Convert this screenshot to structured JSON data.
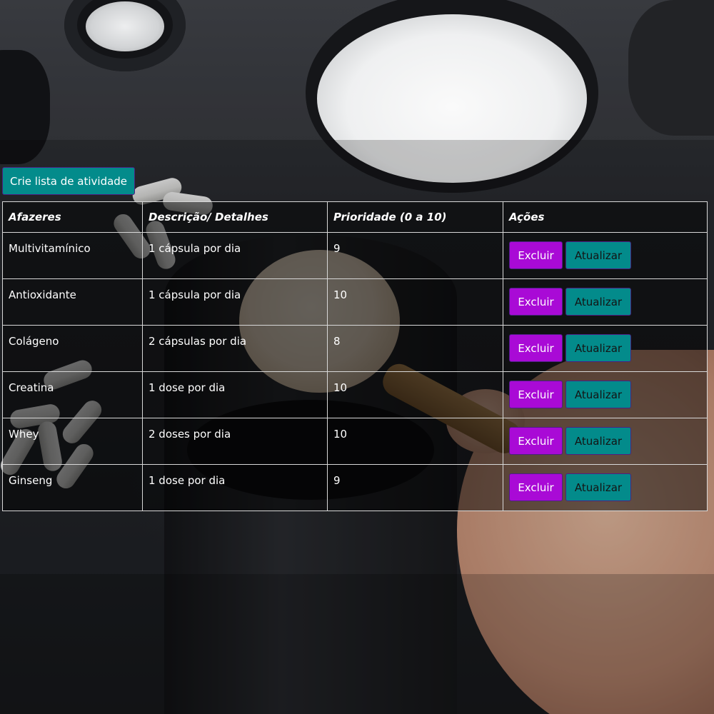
{
  "create_button_label": "Crie lista de atividade",
  "table": {
    "headers": {
      "task": "Afazeres",
      "description": "Descrição/ Detalhes",
      "priority": "Prioridade (0 a 10)",
      "actions": "Ações"
    },
    "rows": [
      {
        "task": "Multivitamínico",
        "description": "1 cápsula por dia",
        "priority": "9",
        "delete_label": "Excluir",
        "update_label": "Atualizar"
      },
      {
        "task": "Antioxidante",
        "description": "1 cápsula por dia",
        "priority": "10",
        "delete_label": "Excluir",
        "update_label": "Atualizar"
      },
      {
        "task": "Colágeno",
        "description": "2 cápsulas por dia",
        "priority": "8",
        "delete_label": "Excluir",
        "update_label": "Atualizar"
      },
      {
        "task": "Creatina",
        "description": "1 dose por dia",
        "priority": "10",
        "delete_label": "Excluir",
        "update_label": "Atualizar"
      },
      {
        "task": "Whey",
        "description": "2 doses por dia",
        "priority": "10",
        "delete_label": "Excluir",
        "update_label": "Atualizar"
      },
      {
        "task": "Ginseng",
        "description": "1 dose por dia",
        "priority": "9",
        "delete_label": "Excluir",
        "update_label": "Atualizar"
      }
    ]
  },
  "colors": {
    "delete_button": "#a90ad6",
    "update_button": "#038b8b",
    "create_button": "#038b8b",
    "button_border": "#4c1f83"
  }
}
